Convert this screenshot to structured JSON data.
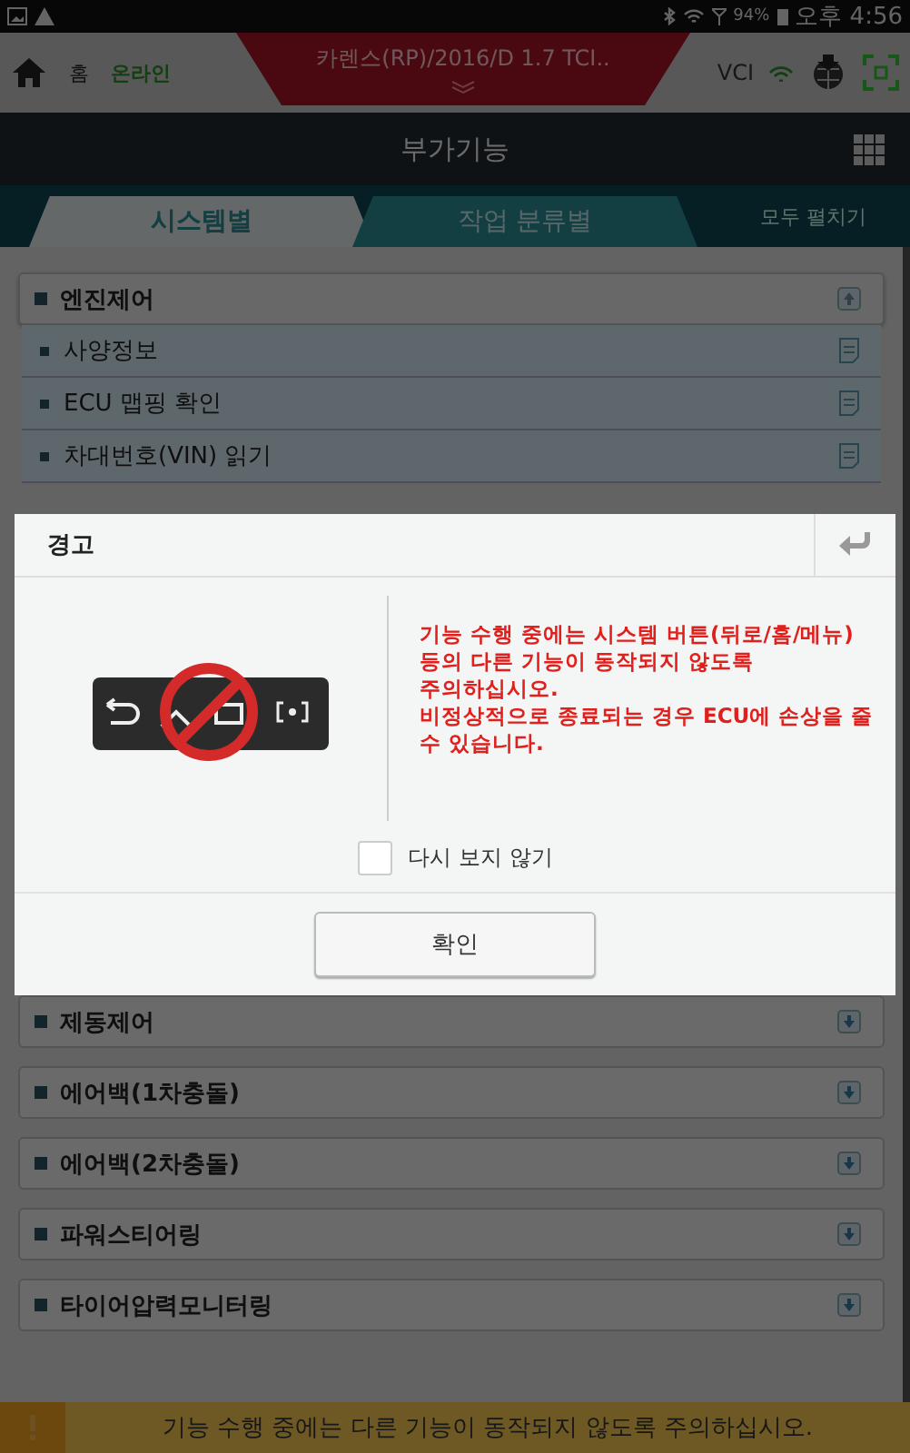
{
  "status_bar": {
    "battery": "94%",
    "time": "오후 4:56"
  },
  "header": {
    "home_label": "홈",
    "connection": "온라인",
    "vehicle": "카렌스(RP)/2016/D 1.7 TCI..",
    "vci": "VCI"
  },
  "title": "부가기능",
  "tabs": [
    {
      "label": "시스템별",
      "selected": true
    },
    {
      "label": "작업 분류별",
      "selected": false
    }
  ],
  "expand_all": "모두 펼치기",
  "groups": [
    {
      "label": "엔진제어",
      "expanded": true,
      "children": [
        {
          "label": "사양정보"
        },
        {
          "label": "ECU 맵핑 확인"
        },
        {
          "label": "차대번호(VIN) 읽기"
        }
      ]
    },
    {
      "label": "제동제어",
      "expanded": false
    },
    {
      "label": "에어백(1차충돌)",
      "expanded": false
    },
    {
      "label": "에어백(2차충돌)",
      "expanded": false
    },
    {
      "label": "파워스티어링",
      "expanded": false
    },
    {
      "label": "타이어압력모니터링",
      "expanded": false
    }
  ],
  "dialog": {
    "title": "경고",
    "message": [
      "기능 수행 중에는 시스템 버튼(뒤로/홈/메뉴)",
      "등의 다른 기능이 동작되지 않도록",
      "주의하십시오.",
      "비정상적으로 종료되는 경우 ECU에 손상을 줄",
      "수 있습니다."
    ],
    "checkbox": {
      "label": "다시 보지 않기",
      "checked": false
    },
    "button": "확인"
  },
  "footer": "기능 수행 중에는 다른 기능이 동작되지 않도록 주의하십시오."
}
